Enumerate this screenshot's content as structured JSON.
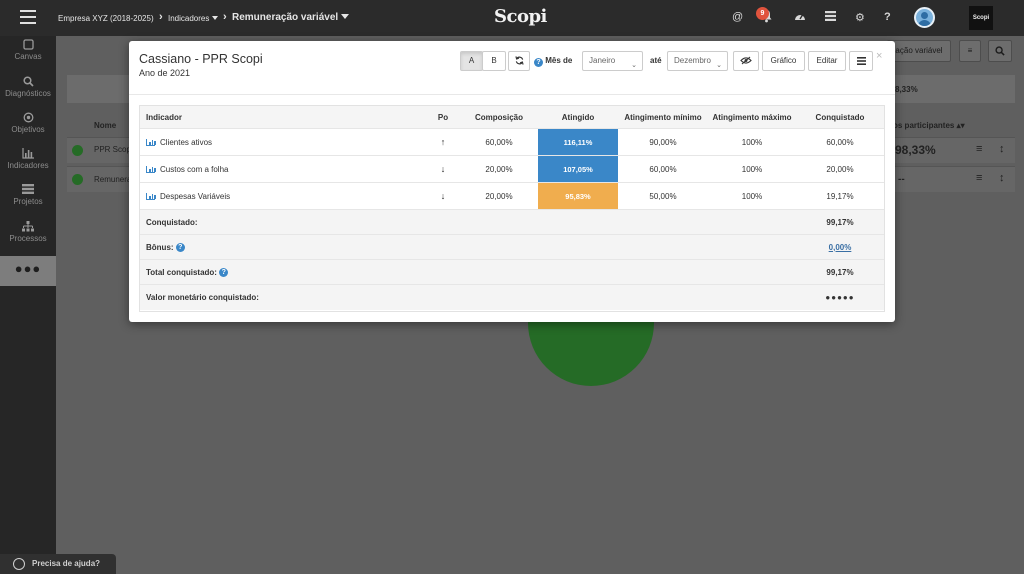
{
  "header": {
    "company": "Empresa XYZ (2018-2025)",
    "indicators": "Indicadores",
    "current": "Remuneração variável",
    "logo": "Scopi",
    "notifications_count": "9",
    "at_icon": "at-icon",
    "brand_label": "Scopi"
  },
  "sidebar": {
    "items": [
      {
        "label": "Canvas",
        "icon": "canvas-icon"
      },
      {
        "label": "Diagnósticos",
        "icon": "search-icon"
      },
      {
        "label": "Objetivos",
        "icon": "target-icon"
      },
      {
        "label": "Indicadores",
        "icon": "bar-chart-icon"
      },
      {
        "label": "Projetos",
        "icon": "projects-icon"
      },
      {
        "label": "Processos",
        "icon": "sitemap-icon"
      }
    ],
    "more": "●●●"
  },
  "background": {
    "action_button": "ação variável",
    "percent": "8,33%",
    "col_name": "Nome",
    "col_participants": "os participantes",
    "rows": [
      {
        "name": "PPR Scop",
        "value": "98,33%"
      },
      {
        "name": "Remunera",
        "value": "--"
      }
    ]
  },
  "help": {
    "label": "Precisa de ajuda?"
  },
  "modal": {
    "title": "Cassiano - PPR Scopi",
    "subtitle": "Ano de 2021",
    "btn_a": "A",
    "btn_b": "B",
    "month_label": "Mês de",
    "month_from": "Janeiro",
    "until_label": "até",
    "month_to": "Dezembro",
    "chart_btn": "Gráfico",
    "edit_btn": "Editar",
    "close": "×",
    "columns": [
      "Indicador",
      "Po",
      "Composição",
      "Atingido",
      "Atingimento mínimo",
      "Atingimento máximo",
      "Conquistado"
    ],
    "rows": [
      {
        "indicator": "Clientes ativos",
        "polarity": "↑",
        "composition": "60,00%",
        "achieved": "116,11%",
        "achieved_color": "#3a87c8",
        "min": "90,00%",
        "max": "100%",
        "conquered": "60,00%"
      },
      {
        "indicator": "Custos com a folha",
        "polarity": "↓",
        "composition": "20,00%",
        "achieved": "107,05%",
        "achieved_color": "#3a87c8",
        "min": "60,00%",
        "max": "100%",
        "conquered": "20,00%"
      },
      {
        "indicator": "Despesas Variáveis",
        "polarity": "↓",
        "composition": "20,00%",
        "achieved": "95,83%",
        "achieved_color": "#f0ad4e",
        "min": "50,00%",
        "max": "100%",
        "conquered": "19,17%"
      }
    ],
    "summary": {
      "conquered_label": "Conquistado:",
      "conquered_value": "99,17%",
      "bonus_label": "Bônus:",
      "bonus_value": "0,00%",
      "total_label": "Total conquistado:",
      "total_value": "99,17%",
      "monetary_label": "Valor monetário conquistado:",
      "monetary_value": "●●●●●"
    }
  }
}
